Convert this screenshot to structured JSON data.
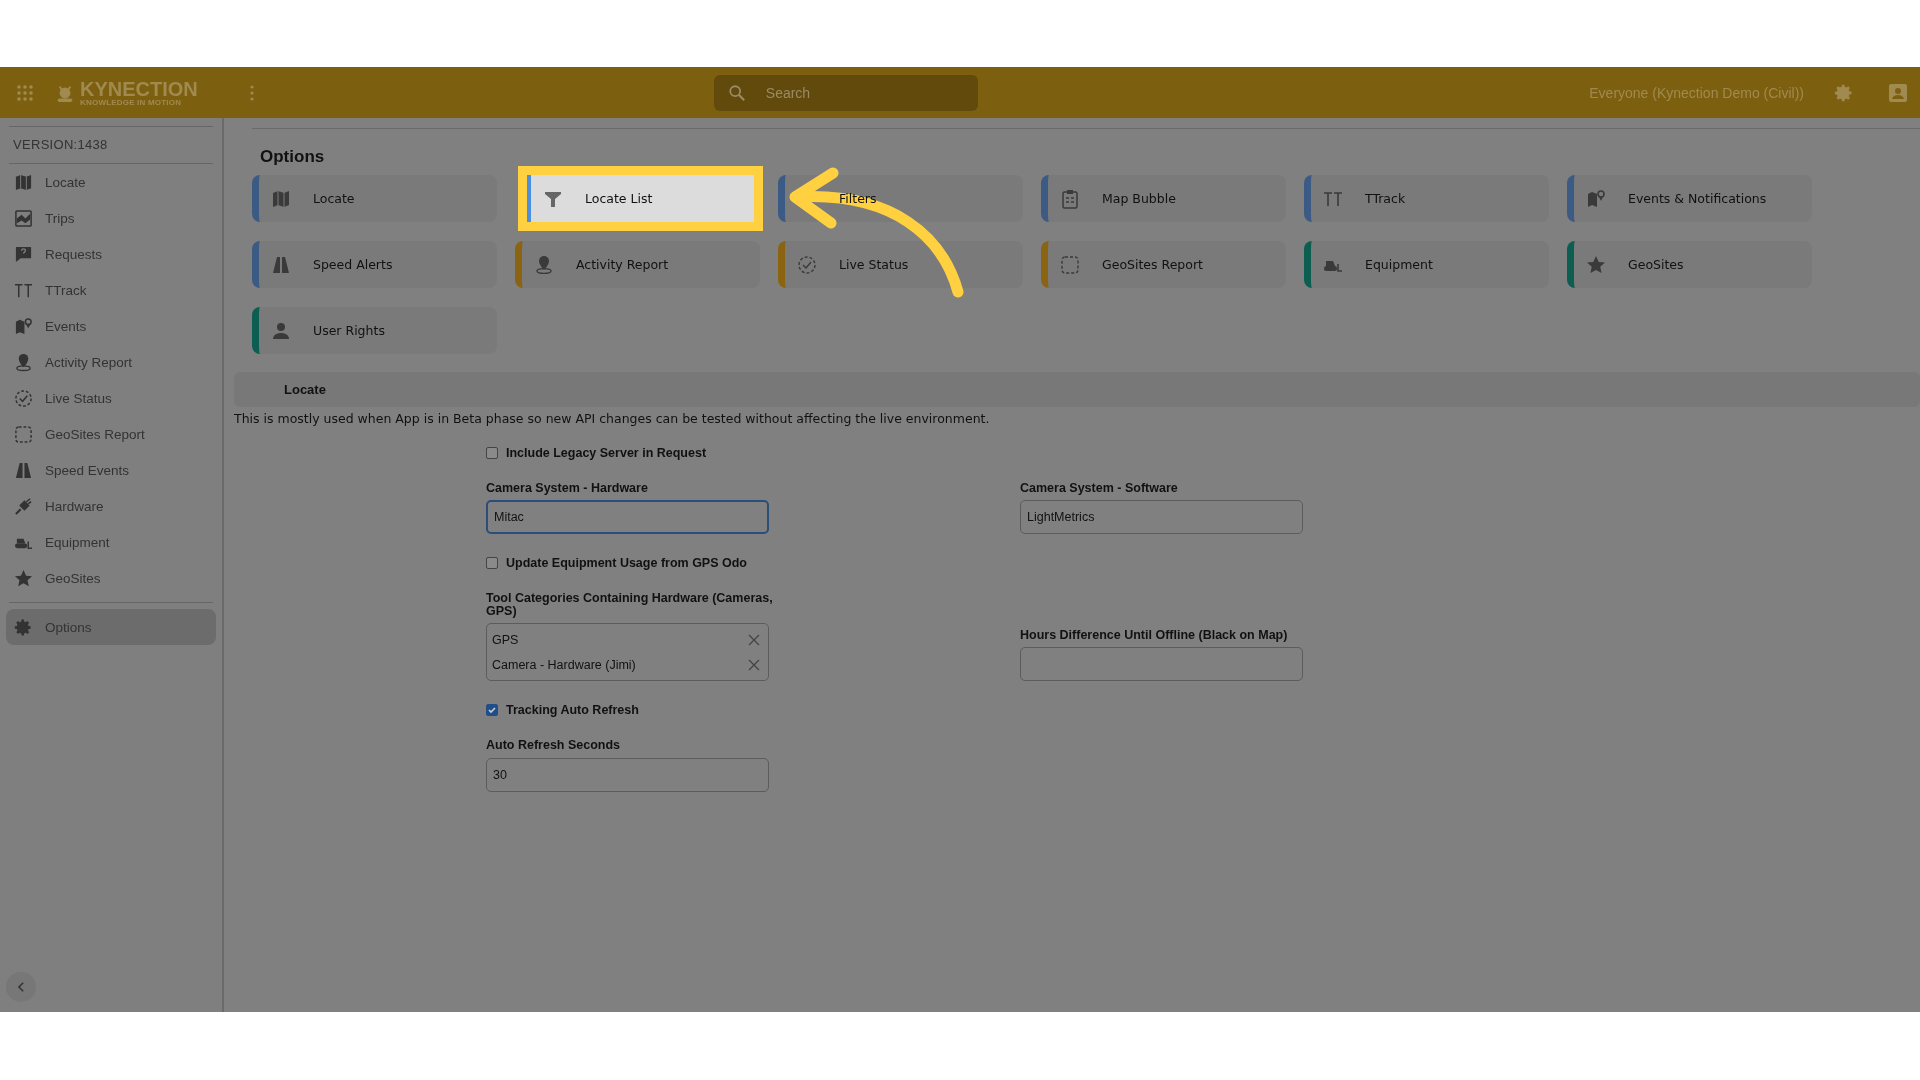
{
  "header": {
    "logo": "KYNECTION",
    "tagline": "KNOWLEDGE IN MOTION",
    "search": {
      "placeholder": "Search"
    },
    "account": "Everyone (Kynection Demo (Civil))"
  },
  "sidebar": {
    "version": "VERSION:1438",
    "items": [
      {
        "label": "Locate",
        "selected": false
      },
      {
        "label": "Trips",
        "selected": false
      },
      {
        "label": "Requests",
        "selected": false
      },
      {
        "label": "TTrack",
        "selected": false
      },
      {
        "label": "Events",
        "selected": false
      },
      {
        "label": "Activity Report",
        "selected": false
      },
      {
        "label": "Live Status",
        "selected": false
      },
      {
        "label": "GeoSites Report",
        "selected": false
      },
      {
        "label": "Speed Events",
        "selected": false
      },
      {
        "label": "Hardware",
        "selected": false
      },
      {
        "label": "Equipment",
        "selected": false
      },
      {
        "label": "GeoSites",
        "selected": false
      }
    ],
    "bottom_items": [
      {
        "label": "Options",
        "selected": true
      }
    ]
  },
  "options": {
    "title": "Options",
    "cards": [
      {
        "label": "Locate",
        "color": "#3b5a84",
        "selected": false
      },
      {
        "label": "Locate List",
        "color": "#4a8fe0",
        "selected": true
      },
      {
        "label": "Filters",
        "color": "#3b5a84",
        "selected": false
      },
      {
        "label": "Map Bubble",
        "color": "#3b5a84",
        "selected": false
      },
      {
        "label": "TTrack",
        "color": "#3b5a84",
        "selected": false
      },
      {
        "label": "Events & Notifications",
        "color": "#3b5a84",
        "selected": false
      },
      {
        "label": "Speed Alerts",
        "color": "#3b5a84",
        "selected": false
      },
      {
        "label": "Activity Report",
        "color": "#8a6410",
        "selected": false
      },
      {
        "label": "Live Status",
        "color": "#8a6410",
        "selected": false
      },
      {
        "label": "GeoSites Report",
        "color": "#8a6410",
        "selected": false
      },
      {
        "label": "Equipment",
        "color": "#0b5e50",
        "selected": false
      },
      {
        "label": "GeoSites",
        "color": "#0b5e50",
        "selected": false
      },
      {
        "label": "User Rights",
        "color": "#0b5e50",
        "selected": false
      }
    ]
  },
  "section": {
    "title": "Locate",
    "description": "This is mostly used when App is in Beta phase so new API changes can be tested without affecting the live environment."
  },
  "form": {
    "rows": [
      {
        "left": {
          "kind": "checkbox",
          "label": "Include Legacy Server in Request",
          "checked": false
        }
      },
      {
        "left": {
          "kind": "input",
          "label": "Camera System - Hardware",
          "value": "Mitac",
          "focused": true
        },
        "right": {
          "kind": "input",
          "label": "Camera System - Software",
          "value": "LightMetrics",
          "focused": false
        }
      },
      {
        "left": {
          "kind": "checkbox",
          "label": "Update Equipment Usage from GPS Odo",
          "checked": false
        }
      },
      {
        "left": {
          "kind": "tags",
          "label": "Tool Categories Containing Hardware (Cameras, GPS)",
          "tags": [
            "GPS",
            "Camera - Hardware (Jimi)"
          ]
        },
        "right": {
          "kind": "input",
          "label": "Hours Difference Until Offline (Black on Map)",
          "focused": false
        }
      },
      {
        "left": {
          "kind": "checkbox",
          "label": "Tracking Auto Refresh",
          "checked": true
        }
      },
      {
        "left": {
          "kind": "input",
          "label": "Auto Refresh Seconds",
          "value": "30",
          "focused": false
        }
      }
    ]
  }
}
